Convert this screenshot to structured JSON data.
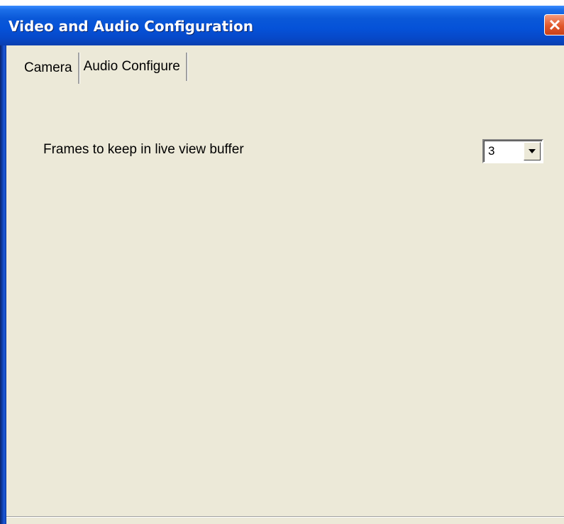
{
  "window": {
    "title": "Video and Audio Configuration",
    "close_icon": "close-icon"
  },
  "tabs": [
    {
      "label": "Camera",
      "active": true
    },
    {
      "label": "Audio Configure",
      "active": false
    }
  ],
  "camera": {
    "buffer_label": "Frames to keep in live view buffer",
    "buffer_value": "3",
    "dropdown_icon": "chevron-down-icon"
  },
  "colors": {
    "titlebar": "#0552d8",
    "window_background": "#ece9d8",
    "close_button": "#e1582a"
  }
}
